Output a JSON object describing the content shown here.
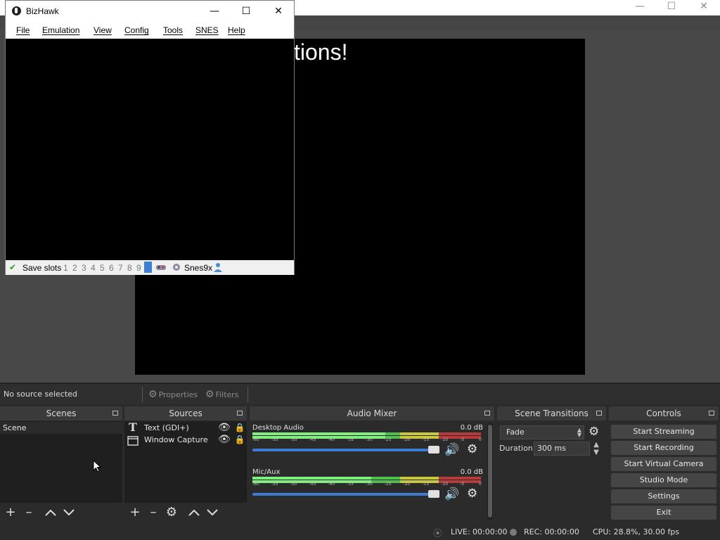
{
  "obs": {
    "preview_text": "tions!",
    "source_bar": {
      "status": "No source selected",
      "properties": "Properties",
      "filters": "Filters"
    },
    "scenes": {
      "title": "Scenes",
      "items": [
        "Scene"
      ]
    },
    "sources": {
      "title": "Sources",
      "items": [
        {
          "label": "Text (GDI+)",
          "icon": "text-icon"
        },
        {
          "label": "Window Capture",
          "icon": "window-icon"
        }
      ]
    },
    "audio_mixer": {
      "title": "Audio Mixer",
      "tracks": [
        {
          "name": "Desktop Audio",
          "db": "0.0 dB",
          "level": 0.58
        },
        {
          "name": "Mic/Aux",
          "db": "0.0 dB",
          "level": 0.52
        }
      ],
      "ticks": [
        "-60",
        "-55",
        "-50",
        "-45",
        "-40",
        "-35",
        "-30",
        "-25",
        "-20",
        "-15",
        "-10",
        "-5",
        "0"
      ]
    },
    "transitions": {
      "title": "Scene Transitions",
      "selected": "Fade",
      "duration_label": "Duration",
      "duration_value": "300 ms"
    },
    "controls": {
      "title": "Controls",
      "buttons": [
        "Start Streaming",
        "Start Recording",
        "Start Virtual Camera",
        "Studio Mode",
        "Settings",
        "Exit"
      ]
    },
    "status": {
      "live": "LIVE: 00:00:00",
      "rec": "REC: 00:00:00",
      "cpu": "CPU: 28.8%, 30.00 fps"
    },
    "colors": {
      "accent": "#3b7bd4",
      "meter_green": "#4fbf4f",
      "meter_yellow": "#c8c83a",
      "meter_red": "#b83a3a"
    }
  },
  "bizhawk": {
    "title": "BizHawk",
    "menu": [
      "File",
      "Emulation",
      "View",
      "Config",
      "Tools",
      "SNES",
      "Help"
    ],
    "status": {
      "save_slots_label": "Save slots",
      "slots": [
        "1",
        "2",
        "3",
        "4",
        "5",
        "6",
        "7",
        "8",
        "9"
      ],
      "core": "Snes9x"
    }
  }
}
